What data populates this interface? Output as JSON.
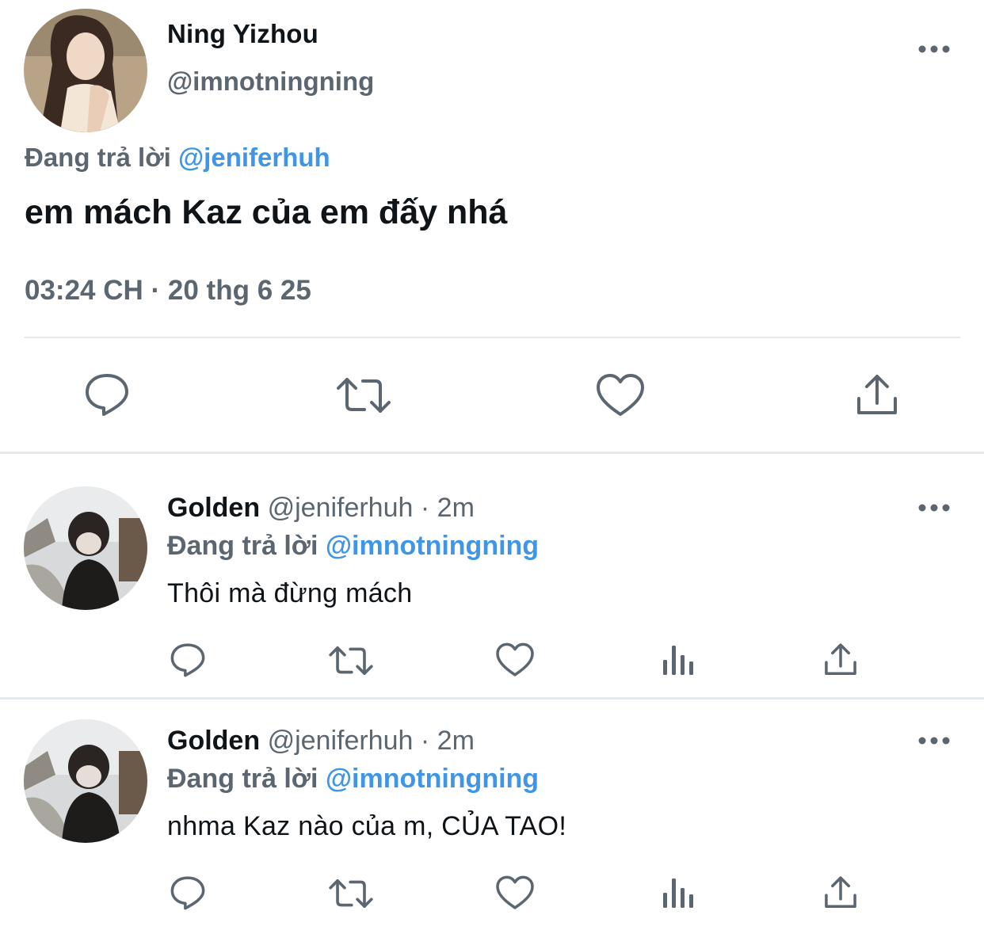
{
  "main_tweet": {
    "display_name": "Ning Yizhou",
    "handle": "@imnotningning",
    "reply_prefix": "Đang trả lời",
    "reply_to": "@jeniferhuh",
    "text": "em mách Kaz của em đấy nhá",
    "timestamp": "03:24 CH · 20 thg 6 25",
    "actions": [
      "reply-icon",
      "retweet-icon",
      "like-icon",
      "share-icon"
    ]
  },
  "replies": [
    {
      "display_name": "Golden",
      "handle": "@jeniferhuh",
      "separator": "·",
      "time": "2m",
      "reply_prefix": "Đang trả lời",
      "reply_to": "@imnotningning",
      "text": "Thôi mà đừng mách",
      "actions": [
        "reply-icon",
        "retweet-icon",
        "like-icon",
        "analytics-icon",
        "share-icon"
      ]
    },
    {
      "display_name": "Golden",
      "handle": "@jeniferhuh",
      "separator": "·",
      "time": "2m",
      "reply_prefix": "Đang trả lời",
      "reply_to": "@imnotningning",
      "text": "nhma Kaz nào của m, CỦA TAO!",
      "actions": [
        "reply-icon",
        "retweet-icon",
        "like-icon",
        "analytics-icon",
        "share-icon"
      ]
    }
  ],
  "colors": {
    "text_primary": "#0f1419",
    "text_secondary": "#5b6670",
    "mention": "#3f95e6",
    "divider": "#e6e9eb",
    "icon": "#5b6670"
  }
}
